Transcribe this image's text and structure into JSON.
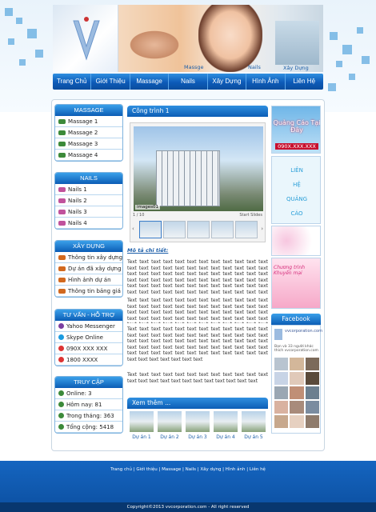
{
  "header": {
    "captions": [
      "Massge",
      "Nails",
      "Xây Dựng"
    ]
  },
  "nav": [
    "Trang Chủ",
    "Giới Thiệu",
    "Massage",
    "Nails",
    "Xây Dựng",
    "Hình Ảnh",
    "Liên Hệ"
  ],
  "massage": {
    "title": "MASSAGE",
    "items": [
      "Massage 1",
      "Massage 2",
      "Massage 3",
      "Massage 4"
    ]
  },
  "nails": {
    "title": "NAILS",
    "items": [
      "Nails 1",
      "Nails 2",
      "Nails 3",
      "Nails 4"
    ]
  },
  "xaydung": {
    "title": "XÂY DỰNG",
    "items": [
      "Thông tin xây dựng",
      "Dự án đã xây dựng",
      "Hình ảnh dự án",
      "Thông tin bảng giá"
    ]
  },
  "support": {
    "title": "TƯ VẤN - HỖ TRỢ",
    "items": [
      "Yahoo Messenger",
      "Skype Online",
      "090X XXX XXX",
      "1800 XXXX"
    ]
  },
  "stats": {
    "title": "TRUY CẬP",
    "items": [
      "Online: 3",
      "Hôm nay: 81",
      "Trong tháng: 363",
      "Tổng cộng: 5418"
    ]
  },
  "content": {
    "title": "Công trình 1",
    "image_caption": "images01",
    "counter": "1 / 10",
    "slideshow": "Start Slides",
    "detail_label": "Mô tả chi tiết:",
    "para1": "Text text text text text text text text text text text text text text text text text text text text text text text text text text text text text text text text text text text text text text text text text text text text text text text text text text text text text text text text text text text text text text text text text text text text text text text text text text text text text text text text text text text text text text text text text text",
    "para2": "Text text text text text text text text text text text text text text text text text text text text text text text text text text text text text text text text text text text text text text text text text text text text text text text text text text text text text text text text text text text text text",
    "para3": "Text text text text text text text text text text text text text text text text text text text text text text text text text text text text text text text text text text text text text text text text text text text text text text text text text text text text text text text text text text text text text text text text text text text",
    "para4": "Text text text text text text text text text text text text text text text text text text text text text text text text"
  },
  "more": {
    "title": "Xem thêm ...",
    "items": [
      "Dự án 1",
      "Dự án 2",
      "Dự án 3",
      "Dự án 4",
      "Dự án 5"
    ]
  },
  "ads": {
    "ad1_title": "Quảng Cáo Tại Đây",
    "ad1_phone": "090X.XXX.XXX",
    "ad2": [
      "LIÊN",
      "HỆ",
      "QUẢNG",
      "CÁO"
    ],
    "ad3": "Chương trình Khuyến mại"
  },
  "facebook": {
    "title": "Facebook",
    "page": "vvcorporation.com",
    "likes": "Bạn và 33 người khác thích vvcorporation.com"
  },
  "footer": {
    "links": "Trang chủ | Giới thiệu | Massage | Nails | Xây dựng | Hình ảnh | Liên hệ",
    "copyright": "Copyright©2013 vvcorporation.com - All right reserved"
  }
}
